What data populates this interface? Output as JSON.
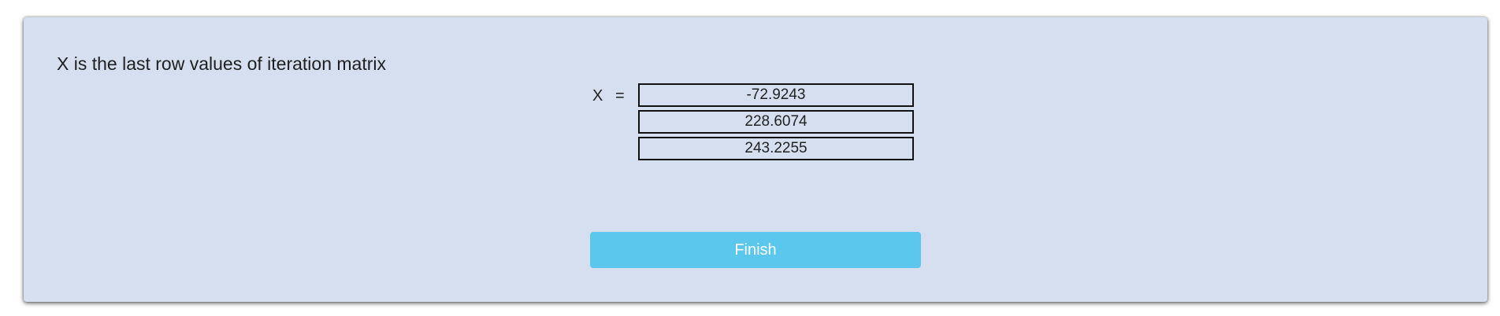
{
  "heading": "X is the last row values of iteration matrix",
  "vector": {
    "label": "X",
    "equals": "=",
    "values": [
      "-72.9243",
      "228.6074",
      "243.2255"
    ]
  },
  "actions": {
    "finish_label": "Finish"
  },
  "colors": {
    "card_background": "#d5dff0",
    "button_background": "#5bc7ec",
    "button_text": "#ffffff",
    "cell_border": "#111111"
  }
}
